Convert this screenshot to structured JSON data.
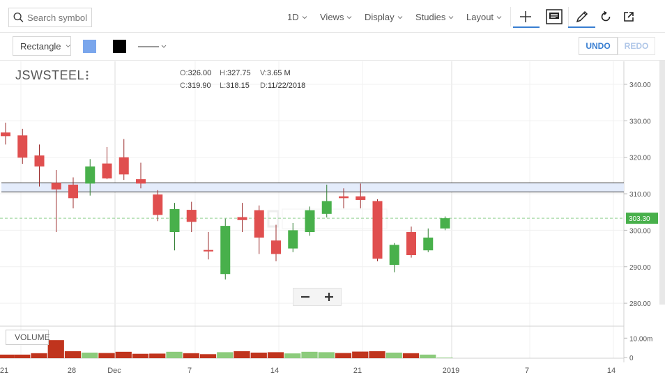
{
  "toolbar": {
    "search_placeholder": "Search symbol",
    "interval": "1D",
    "views": "Views",
    "display": "Display",
    "studies": "Studies",
    "layout": "Layout"
  },
  "drawing": {
    "shape": "Rectangle",
    "fill_color": "#7aa6ec",
    "stroke_color": "#000000",
    "undo": "UNDO",
    "redo": "REDO"
  },
  "chart_data": {
    "type": "candlestick",
    "symbol": "JSWSTEEL",
    "ohlc_readout": {
      "o_label": "O:",
      "o": "326.00",
      "h_label": "H:",
      "h": "327.75",
      "v_label": "V:",
      "v": "3.65 M",
      "c_label": "C:",
      "c": "319.90",
      "l_label": "L:",
      "l": "318.15",
      "d_label": "D:",
      "d": "11/22/2018"
    },
    "y_ticks": [
      "340.00",
      "330.00",
      "320.00",
      "310.00",
      "300.00",
      "290.00",
      "280.00"
    ],
    "y_tick_values": [
      340,
      330,
      320,
      310,
      300,
      290,
      280
    ],
    "ylim": [
      272,
      348
    ],
    "last_price": "303.30",
    "last_price_value": 303.3,
    "band": [
      310.5,
      313
    ],
    "x_labels": [
      "21",
      "28",
      "Dec",
      "7",
      "14",
      "21",
      "2019",
      "7",
      "14"
    ],
    "candles": [
      {
        "o": 326.8,
        "h": 329.5,
        "l": 323.5,
        "c": 325.8
      },
      {
        "o": 326.0,
        "h": 327.8,
        "l": 318.2,
        "c": 319.9
      },
      {
        "o": 320.5,
        "h": 323.5,
        "l": 312.0,
        "c": 317.5
      },
      {
        "o": 313.0,
        "h": 316.5,
        "l": 299.5,
        "c": 311.2
      },
      {
        "o": 312.5,
        "h": 314.5,
        "l": 306.0,
        "c": 308.8
      },
      {
        "o": 312.8,
        "h": 319.5,
        "l": 309.5,
        "c": 317.5
      },
      {
        "o": 318.3,
        "h": 322.8,
        "l": 314.0,
        "c": 314.2
      },
      {
        "o": 320.0,
        "h": 325.0,
        "l": 313.8,
        "c": 315.3
      },
      {
        "o": 314.0,
        "h": 318.5,
        "l": 311.5,
        "c": 312.8
      },
      {
        "o": 309.8,
        "h": 311.0,
        "l": 302.5,
        "c": 304.2
      },
      {
        "o": 299.5,
        "h": 307.5,
        "l": 294.5,
        "c": 305.8
      },
      {
        "o": 305.6,
        "h": 307.8,
        "l": 299.5,
        "c": 302.3
      },
      {
        "o": 294.6,
        "h": 299.5,
        "l": 292.0,
        "c": 294.2
      },
      {
        "o": 288.0,
        "h": 303.2,
        "l": 286.5,
        "c": 301.2
      },
      {
        "o": 303.6,
        "h": 307.5,
        "l": 299.5,
        "c": 302.8
      },
      {
        "o": 305.5,
        "h": 306.8,
        "l": 293.5,
        "c": 298.0
      },
      {
        "o": 297.2,
        "h": 301.5,
        "l": 291.5,
        "c": 293.5
      },
      {
        "o": 295.0,
        "h": 302.0,
        "l": 294.0,
        "c": 300.0
      },
      {
        "o": 299.5,
        "h": 306.5,
        "l": 298.5,
        "c": 305.5
      },
      {
        "o": 304.5,
        "h": 312.5,
        "l": 303.5,
        "c": 308.0
      },
      {
        "o": 309.3,
        "h": 311.5,
        "l": 306.0,
        "c": 308.8
      },
      {
        "o": 309.3,
        "h": 312.8,
        "l": 306.0,
        "c": 308.3
      },
      {
        "o": 308.0,
        "h": 308.5,
        "l": 291.5,
        "c": 292.2
      },
      {
        "o": 290.5,
        "h": 296.5,
        "l": 288.5,
        "c": 296.0
      },
      {
        "o": 299.5,
        "h": 301.0,
        "l": 292.5,
        "c": 293.2
      },
      {
        "o": 294.5,
        "h": 300.5,
        "l": 294.0,
        "c": 298.0
      },
      {
        "o": 300.5,
        "h": 303.8,
        "l": 300.0,
        "c": 303.3
      }
    ],
    "volume": {
      "label": "VOLUME",
      "y_ticks": [
        "10.00m",
        "0"
      ],
      "y_tick_values": [
        10,
        0
      ],
      "ylim": [
        0,
        16
      ],
      "values": [
        1.8,
        1.8,
        2.5,
        9.0,
        3.5,
        2.8,
        2.6,
        3.2,
        2.2,
        2.3,
        3.2,
        2.5,
        2.0,
        3.0,
        3.5,
        2.8,
        3.0,
        2.4,
        3.2,
        3.0,
        2.6,
        3.3,
        3.5,
        2.8,
        2.5,
        1.8,
        0.3
      ]
    }
  }
}
